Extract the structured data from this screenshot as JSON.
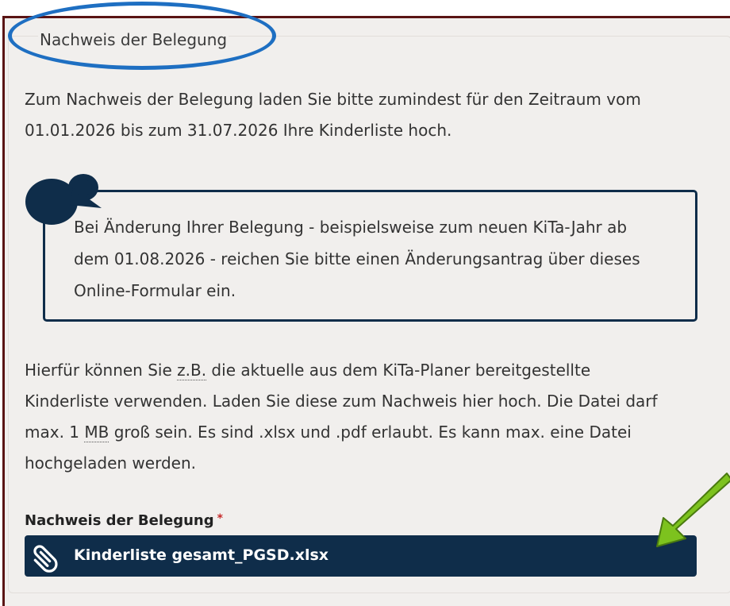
{
  "section": {
    "legend": "Nachweis der Belegung"
  },
  "intro": {
    "line1": "Zum Nachweis der Belegung laden Sie bitte zumindest für den Zeitraum vom",
    "line2": "01.01.2026 bis zum 31.07.2026 Ihre Kinderliste hoch."
  },
  "notice": {
    "icon": "speech-bubble-icon",
    "line1": "Bei Änderung Ihrer Belegung - beispielsweise zum neuen KiTa-Jahr ab",
    "line2": "dem 01.08.2026 - reichen Sie bitte einen Änderungsantrag über dieses",
    "line3": "Online-Formular ein."
  },
  "info": {
    "p1_before": "Hierfür können Sie ",
    "abbr_zb": "z.B.",
    "p1_after": " die aktuelle aus dem KiTa-Planer bereitgestellte",
    "line2": "Kinderliste verwenden. Laden Sie diese zum Nachweis hier hoch. Die Datei darf",
    "line3_before": "max. 1 ",
    "abbr_mb": "MB",
    "line3_after": " groß sein. Es sind .xlsx und .pdf erlaubt. Es kann max. eine Datei",
    "line4": "hochgeladen werden."
  },
  "upload": {
    "label": "Nachweis der Belegung",
    "required_marker": "*",
    "file_icon": "paperclip-icon",
    "file_name": "Kinderliste gesamt_PGSD.xlsx"
  },
  "annotations": {
    "ellipse_color": "#1e6fc2",
    "arrow_color": "#7dc21e"
  },
  "colors": {
    "frame_border": "#5a1414",
    "navy": "#0f2d4a",
    "background": "#f1efed"
  }
}
